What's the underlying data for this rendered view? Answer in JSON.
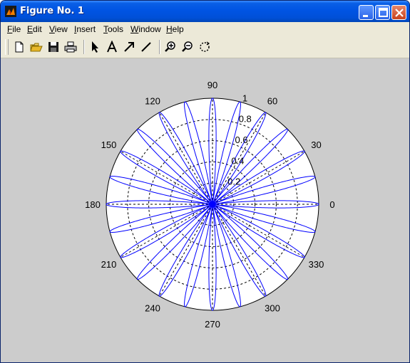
{
  "window": {
    "title": "Figure No. 1",
    "icon": "matlab-icon"
  },
  "menubar": {
    "items": [
      {
        "label": "File",
        "underline": "F",
        "rest": "ile"
      },
      {
        "label": "Edit",
        "underline": "E",
        "rest": "dit"
      },
      {
        "label": "View",
        "underline": "V",
        "rest": "iew"
      },
      {
        "label": "Insert",
        "underline": "I",
        "rest": "nsert"
      },
      {
        "label": "Tools",
        "underline": "T",
        "rest": "ools"
      },
      {
        "label": "Window",
        "underline": "W",
        "rest": "indow"
      },
      {
        "label": "Help",
        "underline": "H",
        "rest": "elp"
      }
    ]
  },
  "toolbar": {
    "buttons": [
      "new-file-icon",
      "open-folder-icon",
      "save-icon",
      "print-icon",
      "select-arrow-icon",
      "insert-text-icon",
      "insert-arrow-icon",
      "insert-line-icon",
      "zoom-in-icon",
      "zoom-out-icon",
      "rotate-icon"
    ]
  },
  "plot": {
    "type": "polar",
    "background": "#cccccc",
    "line_color": "#0000ff",
    "angle_labels": [
      "0",
      "30",
      "60",
      "90",
      "120",
      "150",
      "180",
      "210",
      "240",
      "270",
      "300",
      "330"
    ],
    "radial_labels": [
      "0.2",
      "0.4",
      "0.6",
      "0.8",
      "1"
    ]
  },
  "chart_data": {
    "type": "line",
    "coordinate_system": "polar",
    "series": [
      {
        "function": "r = cos(12*theta)^2",
        "theta_range_deg": [
          0,
          360
        ],
        "petals": 24
      }
    ],
    "rlim": [
      0,
      1
    ],
    "theta_ticks_deg": [
      0,
      30,
      60,
      90,
      120,
      150,
      180,
      210,
      240,
      270,
      300,
      330
    ],
    "r_ticks": [
      0.2,
      0.4,
      0.6,
      0.8,
      1
    ],
    "grid": true
  }
}
